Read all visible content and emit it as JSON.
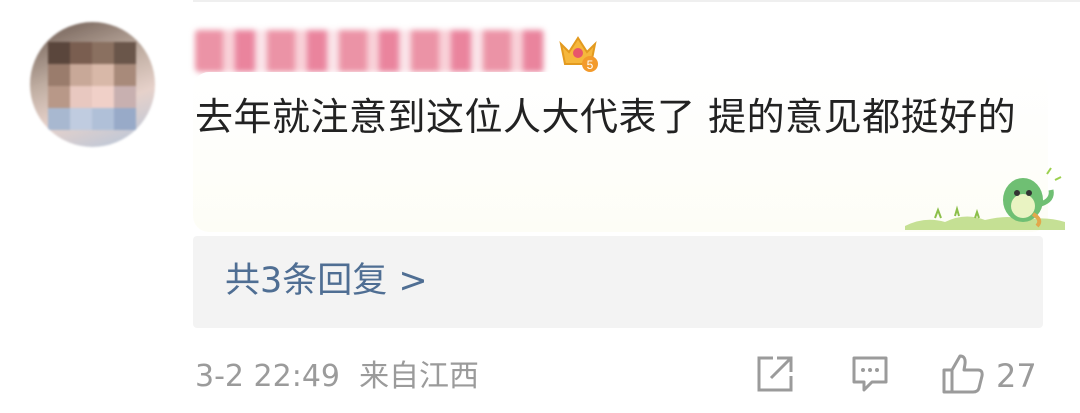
{
  "comment": {
    "username": "",
    "badge_level": "5",
    "text": "去年就注意到这位人大代表了 提的意见都挺好的",
    "reply_link": "共3条回复 >",
    "meta": "3-2 22:49  来自江西",
    "like_count": "27"
  },
  "icons": {
    "crown": "crown-badge-icon",
    "share": "share-icon",
    "comment": "comment-icon",
    "like": "thumbs-up-icon",
    "sticker": "dinosaur-sticker-icon"
  },
  "colors": {
    "text": "#222222",
    "link": "#4f6e93",
    "meta": "#9b9b9b",
    "reply_bg": "#f3f3f3",
    "username_pink": "#e8809a"
  }
}
